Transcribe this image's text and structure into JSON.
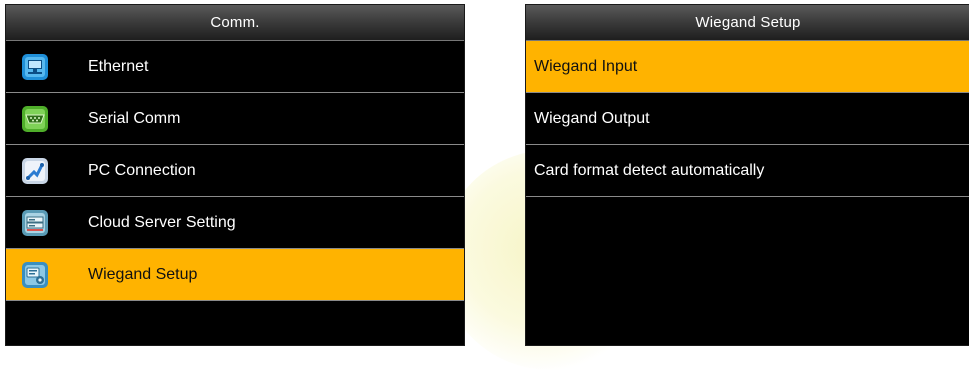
{
  "colors": {
    "selected_background": "#ffb300",
    "screen_background": "#000000",
    "text_default": "#ffffff",
    "text_selected": "#111111"
  },
  "comm_menu": {
    "title": "Comm.",
    "items": [
      {
        "label": "Ethernet",
        "icon": "ethernet-icon",
        "selected": false
      },
      {
        "label": "Serial Comm",
        "icon": "serial-port-icon",
        "selected": false
      },
      {
        "label": "PC Connection",
        "icon": "pc-connection-icon",
        "selected": false
      },
      {
        "label": "Cloud Server Setting",
        "icon": "cloud-server-icon",
        "selected": false
      },
      {
        "label": "Wiegand Setup",
        "icon": "wiegand-icon",
        "selected": true
      }
    ]
  },
  "wiegand_menu": {
    "title": "Wiegand Setup",
    "items": [
      {
        "label": "Wiegand Input",
        "selected": true
      },
      {
        "label": "Wiegand Output",
        "selected": false
      },
      {
        "label": "Card format detect automatically",
        "selected": false
      }
    ]
  }
}
